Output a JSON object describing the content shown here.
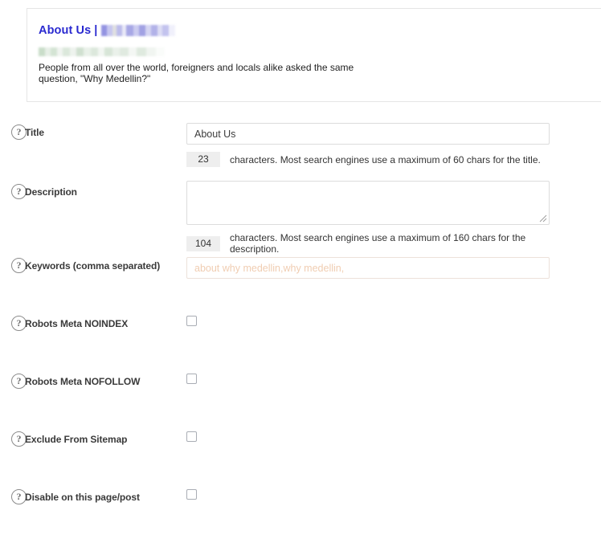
{
  "preview": {
    "title": "About Us",
    "separator": "|",
    "site_name_redacted": "redacted-site-name",
    "url_redacted": "redacted-url",
    "description": "People from all over the world, foreigners and locals alike asked the same question, \"Why Medellin?\""
  },
  "fields": {
    "title": {
      "label": "Title",
      "help_icon": "question-mark-icon",
      "value": "About Us",
      "placeholder": "",
      "count": "23",
      "count_text": "characters. Most search engines use a maximum of 60 chars for the title."
    },
    "description": {
      "label": "Description",
      "help_icon": "question-mark-icon",
      "value": "",
      "placeholder": "",
      "count": "104",
      "count_text": "characters. Most search engines use a maximum of 160 chars for the description."
    },
    "keywords": {
      "label": "Keywords (comma separated)",
      "help_icon": "question-mark-icon",
      "value": "",
      "placeholder": "about why medellin,why medellin,"
    }
  },
  "checkboxes": [
    {
      "label": "Robots Meta NOINDEX",
      "checked": false,
      "help_icon": "question-mark-icon"
    },
    {
      "label": "Robots Meta NOFOLLOW",
      "checked": false,
      "help_icon": "question-mark-icon"
    },
    {
      "label": "Exclude From Sitemap",
      "checked": false,
      "help_icon": "question-mark-icon"
    },
    {
      "label": "Disable on this page/post",
      "checked": false,
      "help_icon": "question-mark-icon"
    }
  ],
  "colors": {
    "preview_title": "#2a2ad0",
    "placeholder_keywords": "#f0cdb2",
    "counter_bg": "#eeeeee",
    "border": "#dcdcdc"
  },
  "help_glyph": "?"
}
